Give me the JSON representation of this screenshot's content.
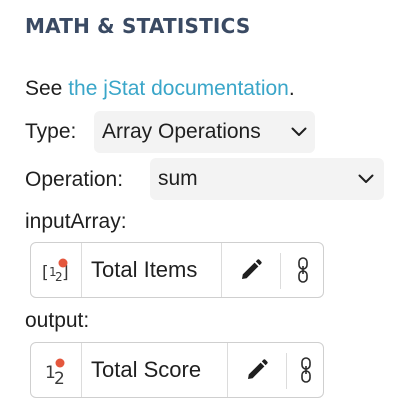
{
  "header": {
    "title": "MATH & STATISTICS"
  },
  "docs": {
    "prefix": "See ",
    "link_text": "the jStat documentation",
    "suffix": "."
  },
  "type_field": {
    "label": "Type:",
    "selected": "Array Operations"
  },
  "operation_field": {
    "label": "Operation:",
    "selected": "sum"
  },
  "input_array": {
    "label": "inputArray:",
    "variable_name": "Total Items",
    "icon": "array-variable-icon"
  },
  "output": {
    "label": "output:",
    "variable_name": "Total Score",
    "icon": "number-variable-icon"
  },
  "colors": {
    "title": "#3a4a63",
    "link": "#3aa6c9",
    "badge_dot": "#e4573d",
    "select_bg": "#f3f3f3"
  }
}
